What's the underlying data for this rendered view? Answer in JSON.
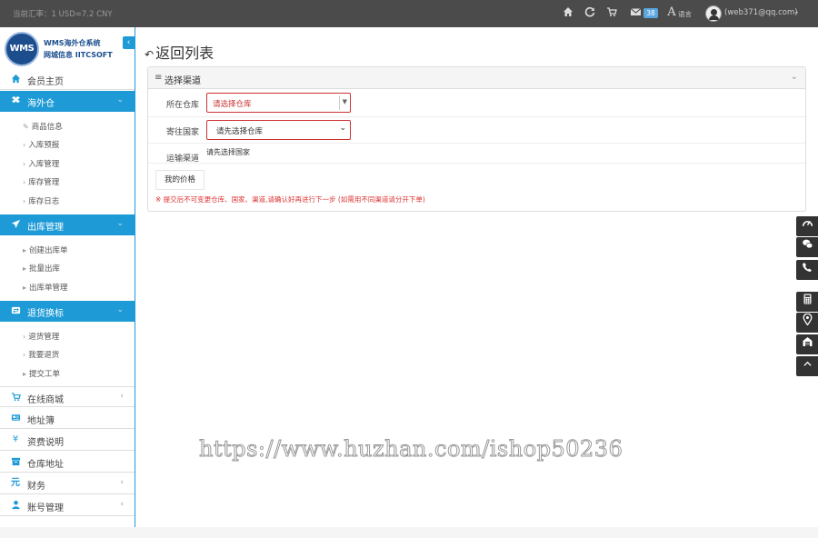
{
  "topbar": {
    "rate_text": "当前汇率：1 USD=7.2 CNY",
    "icons": [
      "home-icon",
      "refresh-icon",
      "cart-icon",
      "mail-icon",
      "language-icon"
    ],
    "mail_count": "38",
    "lang_glyph": "A",
    "lang_label": "语言",
    "user_email": "(web371@qq.com)",
    "user_caret": "⌄"
  },
  "brand": {
    "logo_text": "WMS",
    "line1": "WMS海外仓系统",
    "line2": "网城信息 IITCSOFT",
    "collapse": "‹"
  },
  "sidebar": {
    "home": "会员主页",
    "overseas": "海外仓",
    "overseas_sub": [
      "商品信息",
      "入库预报",
      "入库管理",
      "库存管理",
      "库存日志"
    ],
    "outbound": "出库管理",
    "outbound_sub": [
      "创建出库单",
      "批量出库",
      "出库单管理"
    ],
    "returns": "退货换标",
    "returns_sub": [
      "退货管理",
      "我要退货",
      "提交工单"
    ],
    "mall": "在线商城",
    "address": "地址簿",
    "fees": "资费说明",
    "warehouse_addr": "仓库地址",
    "finance": "财务",
    "account": "账号管理"
  },
  "main": {
    "back_title": "返回列表",
    "panel_title": "选择渠道",
    "warehouse_label": "所在仓库",
    "warehouse_value": "请选择仓库",
    "country_label": "寄往国家",
    "country_value": "请先选择仓库",
    "channel_label": "运输渠道",
    "channel_hint": "请先选择国家",
    "price_button": "我的价格",
    "note": "※ 提交后不可变更仓库、国家、渠道,请确认好再进行下一步 (如需用不同渠道请分开下单)"
  },
  "watermark": "https://www.huzhan.com/ishop50236",
  "colors": {
    "topbar": "#4b4b4b",
    "accent": "#1e9bd7",
    "error": "#cc3333"
  }
}
